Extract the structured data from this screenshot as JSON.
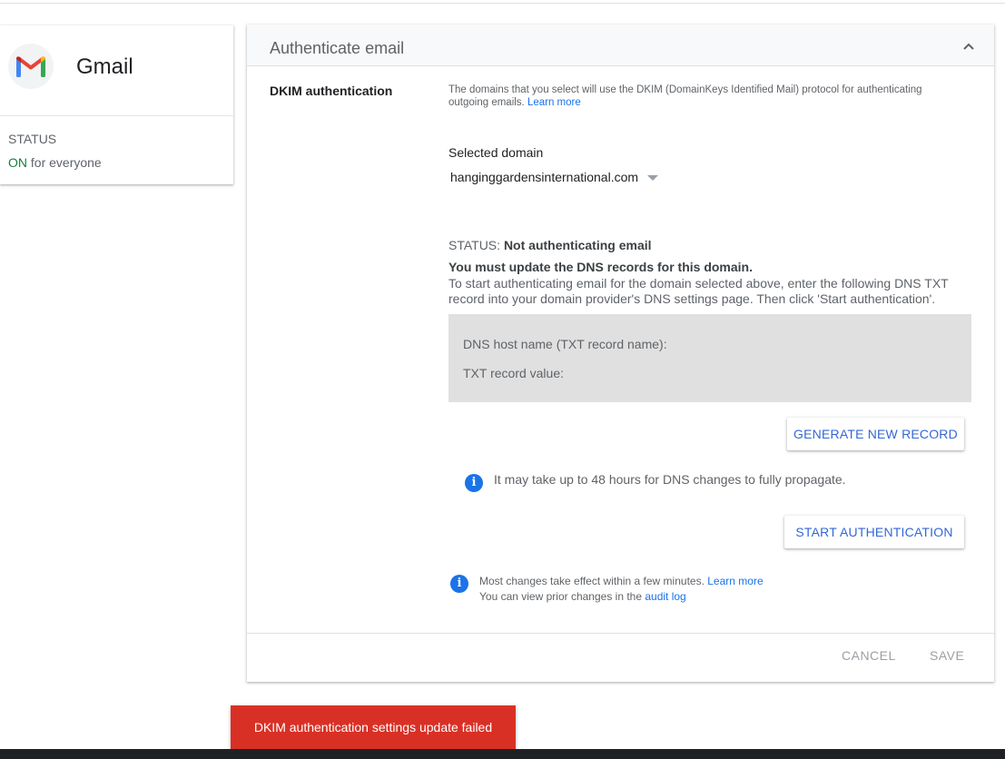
{
  "app": {
    "name": "Gmail",
    "status_label": "STATUS",
    "status_on": "ON",
    "status_scope": " for everyone"
  },
  "section": {
    "title": "Authenticate email",
    "label": "DKIM authentication",
    "description": "The domains that you select will use the DKIM (DomainKeys Identified Mail) protocol for authenticating outgoing emails. ",
    "learn_more": "Learn more"
  },
  "domain": {
    "label": "Selected domain",
    "value": "hanginggardensinternational.com"
  },
  "status": {
    "prefix": "STATUS: ",
    "value": "Not authenticating email",
    "warning_title": "You must update the DNS records for this domain.",
    "warning_body": "To start authenticating email for the domain selected above, enter the following DNS TXT record into your domain provider's DNS settings page. Then click 'Start authentication'."
  },
  "dns": {
    "host_label": "DNS host name (TXT record name):",
    "txt_label": "TXT record value:"
  },
  "buttons": {
    "generate": "GENERATE NEW RECORD",
    "start": "START AUTHENTICATION",
    "cancel": "CANCEL",
    "save": "SAVE"
  },
  "info": {
    "propagation": "It may take up to 48 hours for DNS changes to fully propagate.",
    "changes_text": "Most changes take effect within a few minutes. ",
    "changes_link": "Learn more",
    "audit_text": "You can view prior changes in the ",
    "audit_link": "audit log"
  },
  "toast": {
    "message": "DKIM authentication settings update failed"
  },
  "icons": {
    "app_logo": "gmail-logo-icon",
    "collapse": "chevron-up-icon",
    "dropdown": "dropdown-arrow-icon",
    "info": "info-icon"
  },
  "colors": {
    "accent": "#1a73e8",
    "on_status": "#188038",
    "error_toast": "#d93025"
  }
}
